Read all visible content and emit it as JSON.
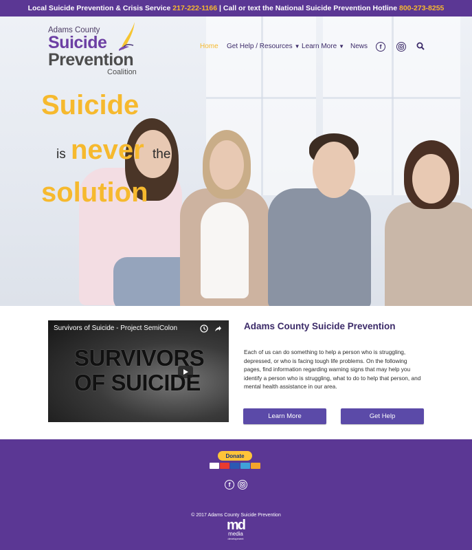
{
  "top_banner": {
    "text_1": "Local Suicide Prevention & Crisis Service",
    "phone_1": "217-222-1166",
    "text_2": "| Call or text the National Suicide Prevention Hotline",
    "phone_2": "800-273-8255"
  },
  "logo": {
    "line1": "Adams County",
    "line2": "Suicide",
    "line3": "Prevention",
    "line4": "Coalition"
  },
  "nav": {
    "home": "Home",
    "get_help": "Get Help / Resources",
    "learn_more": "Learn More",
    "news": "News",
    "facebook_icon": "facebook-icon",
    "instagram_icon": "instagram-icon",
    "search_icon": "search-icon"
  },
  "hero": {
    "word_1": "Suicide",
    "word_2": "is",
    "word_3": "never",
    "word_4": "the",
    "word_5": "solution"
  },
  "video": {
    "title": "Survivors of Suicide - Project SemiColon",
    "overlay_line1": "SURVIVORS",
    "overlay_line2": "OF SUICIDE"
  },
  "intro": {
    "heading": "Adams County Suicide Prevention",
    "body": "Each of us can do something to help a person who is struggling, depressed, or who is facing tough life problems. On the following pages, find information regarding warning signs that may help you identify a person who is struggling, what to do to help that person, and mental health assistance in our area.",
    "learn_more_button": "Learn More",
    "get_help_button": "Get Help"
  },
  "footer": {
    "donate_label": "Donate",
    "copyright": "© 2017 Adams County Suicide Prevention",
    "md_logo": "md",
    "md_line1": "media",
    "md_line2": "development"
  },
  "colors": {
    "brand_purple": "#5b3794",
    "accent_gold": "#f6b92e",
    "button_purple": "#5b4aa8",
    "nav_text": "#3b2a68"
  }
}
